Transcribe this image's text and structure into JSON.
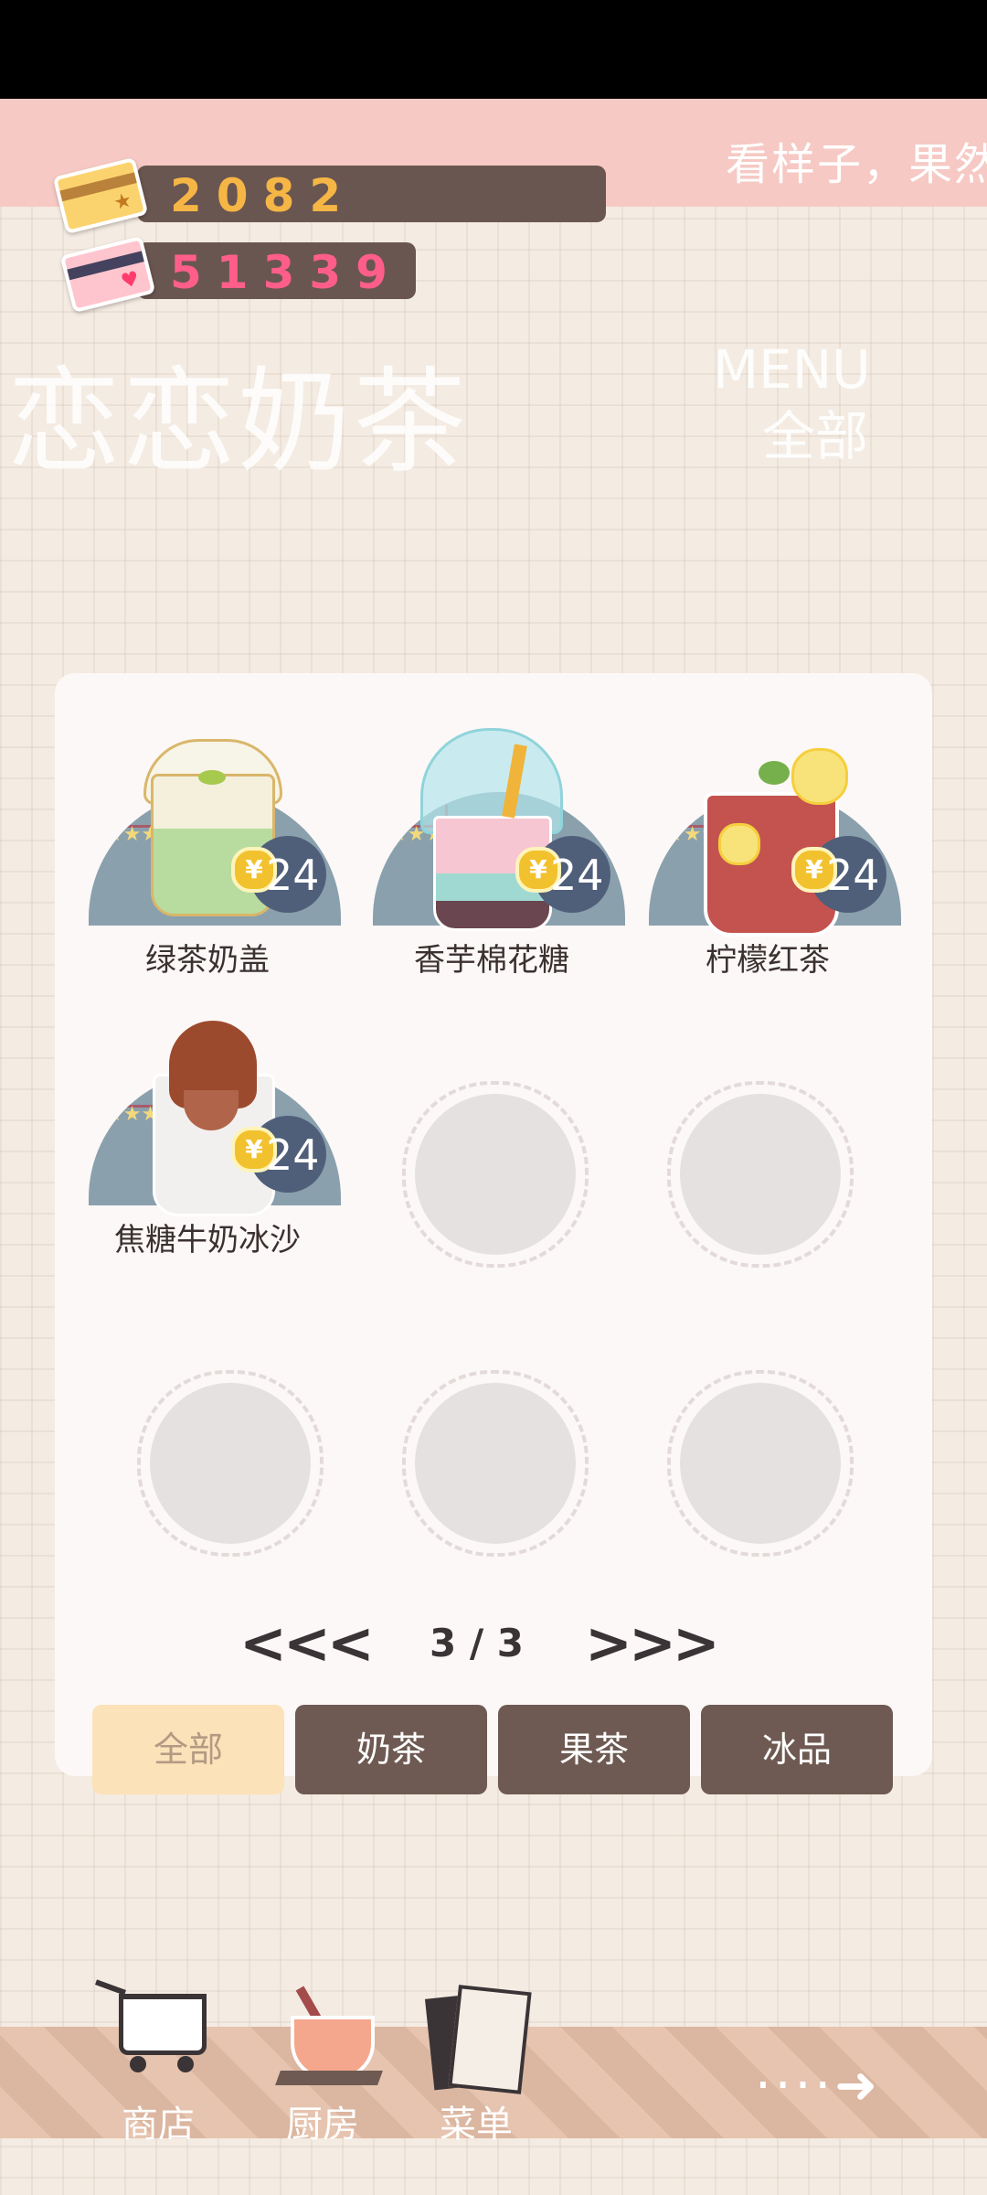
{
  "ticker": {
    "text": "看样子，果然"
  },
  "currency": {
    "gold": "2082",
    "hearts": "51339"
  },
  "header": {
    "shop_name": "恋恋奶茶",
    "menu_label": "MENU",
    "filter_label": "全部"
  },
  "items": [
    {
      "name": "绿茶奶盖",
      "price": "24"
    },
    {
      "name": "香芋棉花糖",
      "price": "24"
    },
    {
      "name": "柠檬红茶",
      "price": "24"
    },
    {
      "name": "焦糖牛奶冰沙",
      "price": "24"
    }
  ],
  "currency_symbol": "¥",
  "pager": {
    "prev": "<<<",
    "text": "3 / 3",
    "next": ">>>"
  },
  "tabs": [
    "全部",
    "奶茶",
    "果茶",
    "冰品"
  ],
  "nav": {
    "shop": "商店",
    "kitchen": "厨房",
    "menu": "菜单",
    "next_arrow": "····➜"
  },
  "colors": {
    "accent": "#6e5a52",
    "active_tab": "#fbe2b8",
    "ticker_bg": "#f6c9c4"
  }
}
